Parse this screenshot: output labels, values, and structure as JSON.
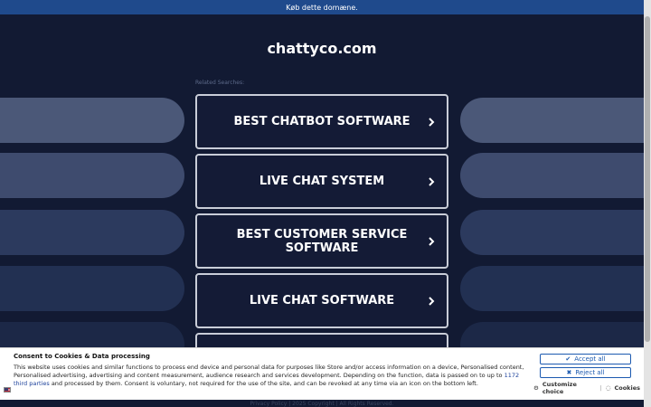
{
  "topbar": {
    "text": "Køb dette domæne."
  },
  "site": {
    "title": "chattyco.com"
  },
  "related_label": "Related Searches:",
  "links": [
    {
      "label": "BEST CHATBOT SOFTWARE"
    },
    {
      "label": "LIVE CHAT SYSTEM"
    },
    {
      "label": "BEST CUSTOMER SERVICE SOFTWARE"
    },
    {
      "label": "LIVE CHAT SOFTWARE"
    },
    {
      "label": ""
    }
  ],
  "footer": {
    "text": "Privacy Policy  |  2025 Copyright | All Rights Reserved."
  },
  "consent": {
    "title": "Consent to Cookies & Data processing",
    "text_before": "This website uses cookies and similar functions to process end device and personal data for purposes like Store and/or access information on a device, Personalised content, Personalised advertising, advertising and content measurement, audience research and services development. Depending on the function, data is passed on to up to ",
    "link_text": "1172 third parties",
    "text_after": " and processed by them. Consent is voluntary, not required for the use of the site, and can be revoked at any time via an icon on the bottom left.",
    "accept_label": "Accept all",
    "reject_label": "Reject all",
    "customize_label": "Customize choice",
    "separator": "|",
    "cookies_label": "Cookies"
  },
  "colors": {
    "background": "#121a33",
    "topbar": "#1f4a8c",
    "button_border": "#c9cdd8",
    "consent_accent": "#1c5ab0"
  },
  "icons": {
    "chevron": "chevron-right-icon",
    "accept": "check-icon",
    "reject": "x-icon",
    "customize": "gear-icon",
    "cookies": "cookie-icon"
  }
}
